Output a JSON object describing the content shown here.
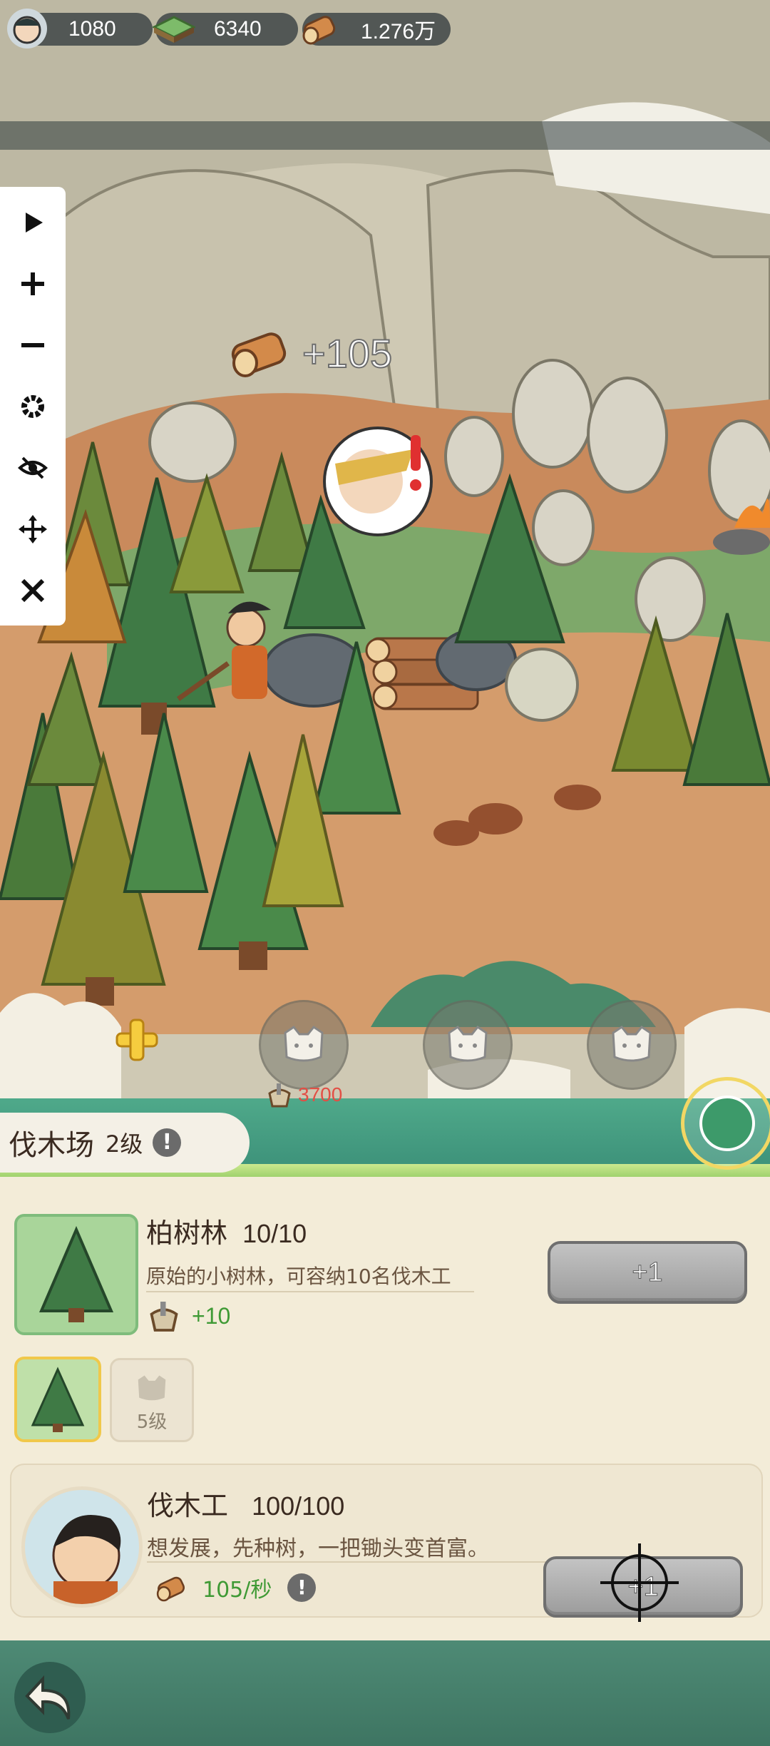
{
  "resources": {
    "population": "1080",
    "land": "6340",
    "wood": "1.276万"
  },
  "toolbar": {
    "items": [
      "play",
      "zoom-in",
      "zoom-out",
      "settings",
      "hide",
      "move",
      "close"
    ]
  },
  "scene": {
    "gain_text": "+105",
    "cost_text": "3700",
    "slots": [
      "locked-worker-1",
      "locked-worker-2",
      "locked-worker-3"
    ]
  },
  "building": {
    "name": "伐木场",
    "level": "2级"
  },
  "forest": {
    "name": "柏树林",
    "count": "10/10",
    "desc": "原始的小树林，可容纳10名伐木工",
    "bonus": "+10",
    "button": "+1"
  },
  "tabs": {
    "locked_label": "5级"
  },
  "worker": {
    "name": "伐木工",
    "count": "100/100",
    "desc": "想发展，先种树，一把锄头变首富。",
    "rate": "105/秒",
    "button": "+1"
  },
  "colors": {
    "green_text": "#3f9a35",
    "red_text": "#e24f45",
    "brown_text": "#5a4330"
  }
}
